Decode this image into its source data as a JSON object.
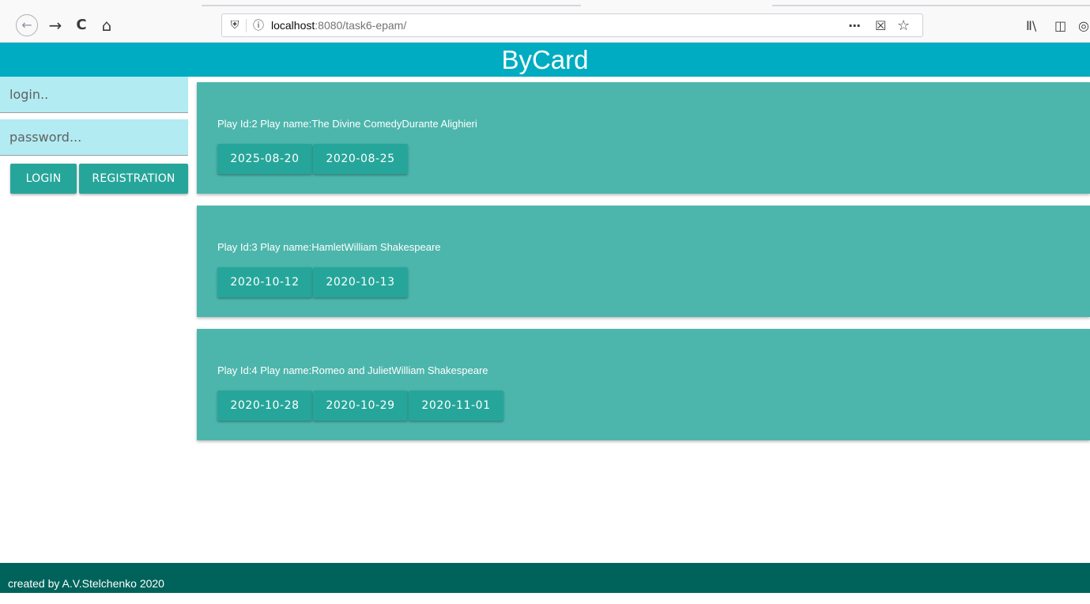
{
  "browser": {
    "url_host": "localhost",
    "url_rest": ":8080/task6-epam/",
    "icons": [
      "back-icon",
      "forward-icon",
      "reload-icon",
      "home-icon",
      "shield-icon",
      "info-icon",
      "more-icon",
      "pocket-icon",
      "bookmark-star-icon",
      "library-icon",
      "sidebar-icon",
      "account-icon"
    ],
    "glyphs": {
      "back": "←",
      "forward": "→",
      "reload": "C",
      "home": "⌂",
      "shield": "⛨",
      "info": "ⓘ",
      "more": "···",
      "pocket": "☒",
      "star": "☆",
      "library": "Ⅱ\\",
      "sidebar": "◫",
      "account": "◎"
    }
  },
  "header": {
    "title": "ByCard"
  },
  "sidebar": {
    "login_placeholder": "login..",
    "password_placeholder": "password...",
    "login_button": "LOGIN",
    "registration_button": "REGISTRATION"
  },
  "plays": [
    {
      "title": "Play Id:2 Play name:The Divine ComedyDurante Alighieri",
      "dates": [
        "2025-08-20",
        "2020-08-25"
      ]
    },
    {
      "title": "Play Id:3 Play name:HamletWilliam Shakespeare",
      "dates": [
        "2020-10-12",
        "2020-10-13"
      ]
    },
    {
      "title": "Play Id:4 Play name:Romeo and JulietWilliam Shakespeare",
      "dates": [
        "2020-10-28",
        "2020-10-29",
        "2020-11-01"
      ]
    }
  ],
  "footer": {
    "text": "created by A.V.Stelchenko 2020"
  },
  "colors": {
    "header": "#00acc1",
    "input_bg": "#b2ebf2",
    "button": "#26a69a",
    "card": "#4db6ac",
    "footer": "#00635b"
  }
}
